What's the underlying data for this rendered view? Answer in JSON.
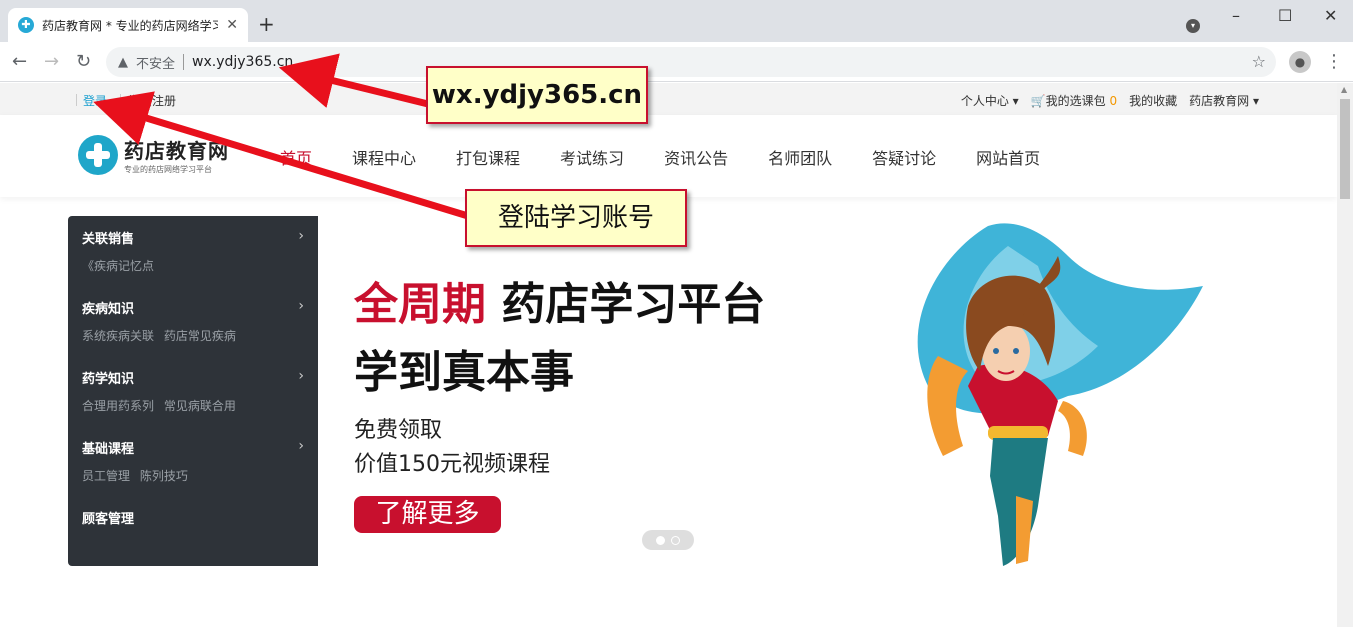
{
  "browser": {
    "tab_title": "药店教育网 * 专业的药店网络学习平台",
    "tab_favicon": "plus",
    "new_tab": "+",
    "close_tab": "✕",
    "security_text": "不安全",
    "url": "wx.ydjy365.cn",
    "window_controls": {
      "minimize": "–",
      "maximize": "☐",
      "close": "✕"
    }
  },
  "site": {
    "topbar": {
      "login": "登录",
      "register": "学员注册",
      "personal_center": "个人中心",
      "my_courses": "我的选课包",
      "my_courses_count": "0",
      "favorites": "我的收藏",
      "site_menu": "药店教育网"
    },
    "logo": {
      "name": "药店教育网",
      "slogan": "专业的药店网络学习平台"
    },
    "nav": [
      {
        "label": "首页",
        "active": true
      },
      {
        "label": "课程中心",
        "active": false
      },
      {
        "label": "打包课程",
        "active": false
      },
      {
        "label": "考试练习",
        "active": false
      },
      {
        "label": "资讯公告",
        "active": false
      },
      {
        "label": "名师团队",
        "active": false
      },
      {
        "label": "答疑讨论",
        "active": false
      },
      {
        "label": "网站首页",
        "active": false
      }
    ],
    "sidebar": [
      {
        "title": "关联销售",
        "sub": "《疾病记忆点",
        "chevron": true
      },
      {
        "title": "疾病知识",
        "sub": "系统疾病关联  药店常见疾病",
        "chevron": true
      },
      {
        "title": "药学知识",
        "sub": "合理用药系列  常见病联合用",
        "chevron": true
      },
      {
        "title": "基础课程",
        "sub": "员工管理  陈列技巧",
        "chevron": true
      },
      {
        "title": "顾客管理",
        "sub": "",
        "chevron": false
      }
    ],
    "banner": {
      "headline_red": "全周期",
      "headline_rest": " 药店学习平台",
      "headline2": "学到真本事",
      "sub1": "免费领取",
      "sub2": "价值150元视频课程",
      "cta": "了解更多",
      "slides": 2,
      "active_slide": 1
    }
  },
  "annotations": {
    "url_callout": "wx.ydjy365.cn",
    "login_callout": "登陆学习账号"
  },
  "colors": {
    "accent_red": "#c8102e",
    "link_blue": "#1a9fcf",
    "sidebar_bg": "#2e3339",
    "callout_bg": "#ffffc8"
  }
}
